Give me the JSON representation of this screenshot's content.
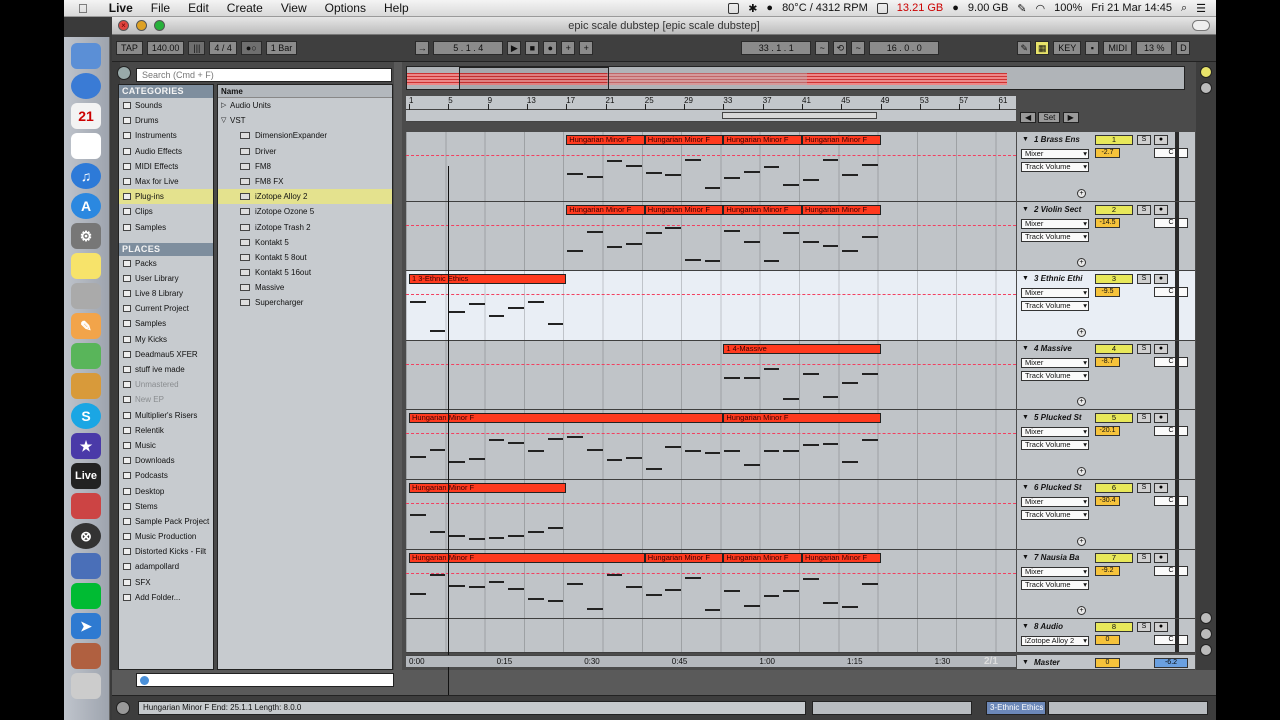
{
  "menubar": {
    "apple": "",
    "app_name": "Live",
    "menus": [
      "File",
      "Edit",
      "Create",
      "View",
      "Options",
      "Help"
    ],
    "status_temp": "80°C / 4312 RPM",
    "status_mem1": "13.21 GB",
    "status_mem2": "9.00 GB",
    "battery": "100%",
    "clock": "Fri 21 Mar  14:45"
  },
  "window": {
    "title": "epic scale dubstep  [epic scale dubstep]"
  },
  "control_bar": {
    "tap": "TAP",
    "tempo": "140.00",
    "signature": "4 / 4",
    "quantize": "1 Bar",
    "position": "5 .  1 .  4",
    "loop_start": "33 .  1 .  1",
    "loop_length": "16 .  0 .  0",
    "key": "KEY",
    "midi": "MIDI",
    "cpu": "13 %",
    "d": "D"
  },
  "browser": {
    "search_placeholder": "Search (Cmd + F)",
    "categories_title": "CATEGORIES",
    "categories": [
      {
        "label": "Sounds",
        "selected": false
      },
      {
        "label": "Drums",
        "selected": false
      },
      {
        "label": "Instruments",
        "selected": false
      },
      {
        "label": "Audio Effects",
        "selected": false
      },
      {
        "label": "MIDI Effects",
        "selected": false
      },
      {
        "label": "Max for Live",
        "selected": false
      },
      {
        "label": "Plug-ins",
        "selected": true
      },
      {
        "label": "Clips",
        "selected": false
      },
      {
        "label": "Samples",
        "selected": false
      }
    ],
    "places_title": "PLACES",
    "places": [
      {
        "label": "Packs",
        "dim": false
      },
      {
        "label": "User Library",
        "dim": false
      },
      {
        "label": "Live 8 Library",
        "dim": false
      },
      {
        "label": "Current Project",
        "dim": false
      },
      {
        "label": "Samples",
        "dim": false
      },
      {
        "label": "My Kicks",
        "dim": false
      },
      {
        "label": "Deadmau5 XFER",
        "dim": false
      },
      {
        "label": "stuff ive made",
        "dim": false
      },
      {
        "label": "Unmastered",
        "dim": true
      },
      {
        "label": "New EP",
        "dim": true
      },
      {
        "label": "Multiplier's Risers",
        "dim": false
      },
      {
        "label": "Relentik",
        "dim": false
      },
      {
        "label": "Music",
        "dim": false
      },
      {
        "label": "Downloads",
        "dim": false
      },
      {
        "label": "Podcasts",
        "dim": false
      },
      {
        "label": "Desktop",
        "dim": false
      },
      {
        "label": "Stems",
        "dim": false
      },
      {
        "label": "Sample Pack Project",
        "dim": false
      },
      {
        "label": "Music Production",
        "dim": false
      },
      {
        "label": "Distorted Kicks - Filt",
        "dim": false
      },
      {
        "label": "adampollard",
        "dim": false
      },
      {
        "label": "SFX",
        "dim": false
      },
      {
        "label": "Add Folder...",
        "dim": false
      }
    ],
    "name_header": "Name",
    "files": [
      {
        "label": "Audio Units",
        "folder": true,
        "open": false,
        "selected": false
      },
      {
        "label": "VST",
        "folder": true,
        "open": true,
        "selected": false
      },
      {
        "label": "DimensionExpander",
        "folder": false,
        "selected": false
      },
      {
        "label": "Driver",
        "folder": false,
        "selected": false
      },
      {
        "label": "FM8",
        "folder": false,
        "selected": false
      },
      {
        "label": "FM8 FX",
        "folder": false,
        "selected": false
      },
      {
        "label": "iZotope Alloy 2",
        "folder": false,
        "selected": true
      },
      {
        "label": "iZotope Ozone 5",
        "folder": false,
        "selected": false
      },
      {
        "label": "iZotope Trash 2",
        "folder": false,
        "selected": false
      },
      {
        "label": "Kontakt 5",
        "folder": false,
        "selected": false
      },
      {
        "label": "Kontakt 5 8out",
        "folder": false,
        "selected": false
      },
      {
        "label": "Kontakt 5 16out",
        "folder": false,
        "selected": false
      },
      {
        "label": "Massive",
        "folder": false,
        "selected": false
      },
      {
        "label": "Supercharger",
        "folder": false,
        "selected": false
      }
    ]
  },
  "arrangement": {
    "ruler": [
      "1",
      "5",
      "9",
      "13",
      "17",
      "21",
      "25",
      "29",
      "33",
      "37",
      "41",
      "45",
      "49",
      "53",
      "57",
      "61"
    ],
    "set_label": "Set",
    "timeline": [
      "0:00",
      "0:15",
      "0:30",
      "0:45",
      "1:00",
      "1:15",
      "1:30"
    ],
    "page": "2/1",
    "tracks": [
      {
        "name": "1 Brass Ens",
        "num": "1",
        "device": "Mixer",
        "automation": "Track Volume",
        "vol": "-2.7",
        "pan": "C",
        "highlight": false,
        "clips": [
          {
            "label": "Hungarian Minor F",
            "bar": 17,
            "bars": 8
          },
          {
            "label": "Hungarian Minor F",
            "bar": 25,
            "bars": 8
          },
          {
            "label": "Hungarian Minor F",
            "bar": 33,
            "bars": 8
          },
          {
            "label": "Hungarian Minor F",
            "bar": 41,
            "bars": 8
          }
        ]
      },
      {
        "name": "2 Violin Sect",
        "num": "2",
        "device": "Mixer",
        "automation": "Track Volume",
        "vol": "-14.5",
        "pan": "C",
        "highlight": false,
        "clips": [
          {
            "label": "Hungarian Minor F",
            "bar": 17,
            "bars": 8
          },
          {
            "label": "Hungarian Minor F",
            "bar": 25,
            "bars": 8
          },
          {
            "label": "Hungarian Minor F",
            "bar": 33,
            "bars": 8
          },
          {
            "label": "Hungarian Minor F",
            "bar": 41,
            "bars": 8
          }
        ]
      },
      {
        "name": "3 Ethnic Ethi",
        "num": "3",
        "device": "Mixer",
        "automation": "Track Volume",
        "vol": "-9.5",
        "pan": "C",
        "highlight": true,
        "clips": [
          {
            "label": "1 3-Ethnic Ethics",
            "bar": 1,
            "bars": 16
          }
        ]
      },
      {
        "name": "4 Massive",
        "num": "4",
        "device": "Mixer",
        "automation": "Track Volume",
        "vol": "-8.7",
        "pan": "C",
        "highlight": false,
        "clips": [
          {
            "label": "1 4-Massive",
            "bar": 33,
            "bars": 16
          }
        ]
      },
      {
        "name": "5 Plucked St",
        "num": "5",
        "device": "Mixer",
        "automation": "Track Volume",
        "vol": "-20.1",
        "pan": "C",
        "highlight": false,
        "clips": [
          {
            "label": "Hungarian Minor F",
            "bar": 1,
            "bars": 32
          },
          {
            "label": "Hungarian Minor F",
            "bar": 33,
            "bars": 16
          }
        ]
      },
      {
        "name": "6 Plucked St",
        "num": "6",
        "device": "Mixer",
        "automation": "Track Volume",
        "vol": "-30.4",
        "pan": "C",
        "highlight": false,
        "clips": [
          {
            "label": "Hungarian Minor F",
            "bar": 1,
            "bars": 16
          }
        ]
      },
      {
        "name": "7 Nausia Ba",
        "num": "7",
        "device": "Mixer",
        "automation": "Track Volume",
        "vol": "-9.2",
        "pan": "C",
        "highlight": false,
        "clips": [
          {
            "label": "Hungarian Minor F",
            "bar": 1,
            "bars": 24
          },
          {
            "label": "Hungarian Minor F",
            "bar": 25,
            "bars": 8
          },
          {
            "label": "Hungarian Minor F",
            "bar": 33,
            "bars": 8
          },
          {
            "label": "Hungarian Minor F",
            "bar": 41,
            "bars": 8
          }
        ]
      },
      {
        "name": "8 Audio",
        "num": "8",
        "device": "iZotope Alloy 2",
        "automation": "",
        "vol": "0",
        "pan": "C",
        "highlight": false,
        "clips": []
      }
    ],
    "master": {
      "name": "Master",
      "vol": "0",
      "pan": "-6.2"
    }
  },
  "status": {
    "text": "Hungarian Minor F  End: 25.1.1  Length: 8.0.0",
    "track": "3-Ethnic Ethics"
  },
  "colors": {
    "clip": "#ff3a1f",
    "selection": "#e4e28e",
    "loop_marker": "#f24060"
  }
}
